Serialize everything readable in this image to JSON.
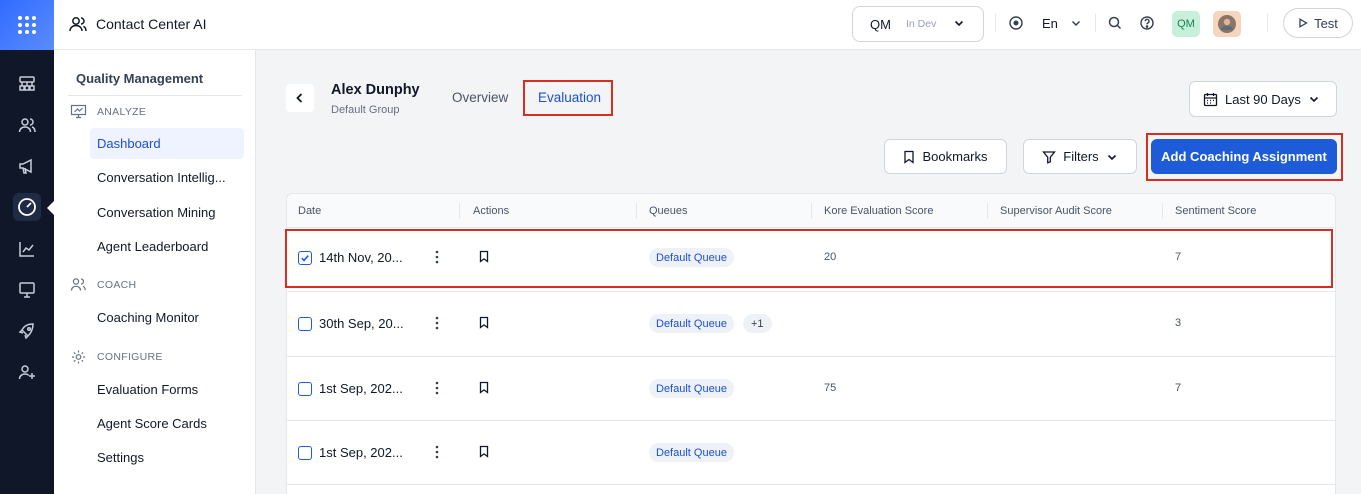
{
  "topbar": {
    "app_title": "Contact Center AI",
    "env_name": "QM",
    "env_tag": "In Dev",
    "language": "En",
    "user_initials": "QM",
    "test_label": "Test"
  },
  "sidebar": {
    "title": "Quality Management",
    "sections": {
      "analyze": "ANALYZE",
      "coach": "COACH",
      "configure": "CONFIGURE"
    },
    "items": [
      {
        "label": "Dashboard"
      },
      {
        "label": "Conversation Intellig..."
      },
      {
        "label": "Conversation Mining"
      },
      {
        "label": "Agent Leaderboard"
      },
      {
        "label": "Coaching Monitor"
      },
      {
        "label": "Evaluation Forms"
      },
      {
        "label": "Agent Score Cards"
      },
      {
        "label": "Settings"
      }
    ]
  },
  "header": {
    "agent_name": "Alex Dunphy",
    "agent_group": "Default Group",
    "tabs": [
      {
        "label": "Overview"
      },
      {
        "label": "Evaluation"
      }
    ],
    "date_range": "Last 90 Days"
  },
  "toolbar": {
    "bookmarks_label": "Bookmarks",
    "filters_label": "Filters",
    "add_coaching_label": "Add Coaching Assignment"
  },
  "table": {
    "columns": [
      "Date",
      "Actions",
      "Queues",
      "Kore Evaluation Score",
      "Supervisor Audit Score",
      "Sentiment Score"
    ],
    "rows": [
      {
        "date": "14th Nov, 20...",
        "queue": "Default Queue",
        "extra_queues": "",
        "kore_score": "20",
        "audit_score": "",
        "sentiment": "7",
        "checked": true
      },
      {
        "date": "30th Sep, 20...",
        "queue": "Default Queue",
        "extra_queues": "+1",
        "kore_score": "",
        "audit_score": "",
        "sentiment": "3",
        "checked": false
      },
      {
        "date": "1st Sep, 202...",
        "queue": "Default Queue",
        "extra_queues": "",
        "kore_score": "75",
        "audit_score": "",
        "sentiment": "7",
        "checked": false
      },
      {
        "date": "1st Sep, 202...",
        "queue": "Default Queue",
        "extra_queues": "",
        "kore_score": "",
        "audit_score": "",
        "sentiment": "",
        "checked": false
      }
    ]
  },
  "colors": {
    "primary": "#1d5bd8",
    "highlight": "#d92d20",
    "rail": "#0f1729"
  }
}
